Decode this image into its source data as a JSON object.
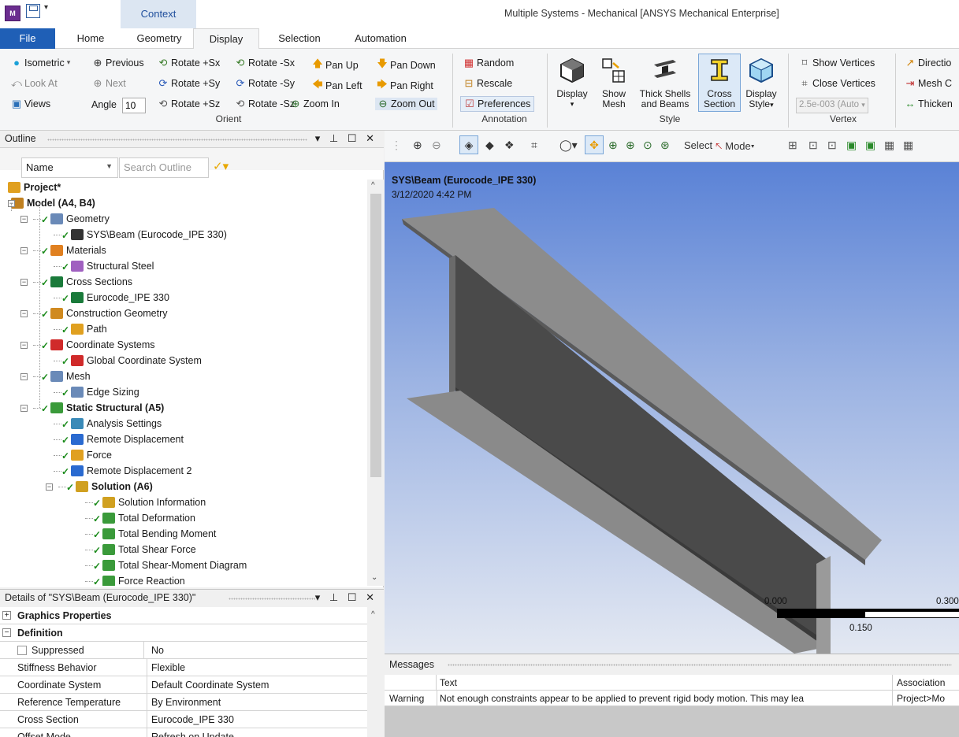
{
  "titlebar": {
    "app_icon": "M",
    "context_tab": "Context",
    "window_title": "Multiple Systems - Mechanical [ANSYS Mechanical Enterprise]"
  },
  "tabs": [
    "File",
    "Home",
    "Geometry",
    "Display",
    "Selection",
    "Automation"
  ],
  "active_tab": "Display",
  "ribbon": {
    "orient": {
      "isometric": "Isometric",
      "previous": "Previous",
      "look_at": "Look At",
      "next": "Next",
      "views": "Views",
      "angle_label": "Angle",
      "angle_value": "10",
      "rotate_psx": "Rotate +Sx",
      "rotate_msx": "Rotate -Sx",
      "rotate_psy": "Rotate +Sy",
      "rotate_msy": "Rotate -Sy",
      "rotate_psz": "Rotate +Sz",
      "rotate_msz": "Rotate -Sz",
      "pan_up": "Pan Up",
      "pan_down": "Pan Down",
      "pan_left": "Pan Left",
      "pan_right": "Pan Right",
      "zoom_in": "Zoom In",
      "zoom_out": "Zoom Out",
      "group_label": "Orient"
    },
    "annotation": {
      "random": "Random",
      "rescale": "Rescale",
      "preferences": "Preferences",
      "group_label": "Annotation"
    },
    "style": {
      "display": "Display",
      "show_mesh_1": "Show",
      "show_mesh_2": "Mesh",
      "thick_1": "Thick Shells",
      "thick_2": "and Beams",
      "cross_1": "Cross",
      "cross_2": "Section",
      "dstyle_1": "Display",
      "dstyle_2": "Style",
      "group_label": "Style"
    },
    "vertex": {
      "show_vertices": "Show Vertices",
      "close_vertices": "Close Vertices",
      "value": "2.5e-003 (Auto",
      "group_label": "Vertex"
    },
    "edge": {
      "direction": "Directio",
      "mesh_c": "Mesh C",
      "thicken": "Thicken"
    }
  },
  "outline": {
    "title": "Outline",
    "name_filter": "Name",
    "search_placeholder": "Search Outline",
    "tree": [
      {
        "label": "Project*",
        "bold": true
      },
      {
        "label": "Model (A4, B4)",
        "bold": true
      },
      {
        "label": "Geometry",
        "bold": false
      },
      {
        "label": "SYS\\Beam (Eurocode_IPE 330)",
        "bold": false
      },
      {
        "label": "Materials",
        "bold": false
      },
      {
        "label": "Structural Steel",
        "bold": false
      },
      {
        "label": "Cross Sections",
        "bold": false
      },
      {
        "label": "Eurocode_IPE 330",
        "bold": false
      },
      {
        "label": "Construction Geometry",
        "bold": false
      },
      {
        "label": "Path",
        "bold": false
      },
      {
        "label": "Coordinate Systems",
        "bold": false
      },
      {
        "label": "Global Coordinate System",
        "bold": false
      },
      {
        "label": "Mesh",
        "bold": false
      },
      {
        "label": "Edge Sizing",
        "bold": false
      },
      {
        "label": "Static Structural (A5)",
        "bold": true
      },
      {
        "label": "Analysis Settings",
        "bold": false
      },
      {
        "label": "Remote Displacement",
        "bold": false
      },
      {
        "label": "Force",
        "bold": false
      },
      {
        "label": "Remote Displacement 2",
        "bold": false
      },
      {
        "label": "Solution (A6)",
        "bold": true
      },
      {
        "label": "Solution Information",
        "bold": false
      },
      {
        "label": "Total Deformation",
        "bold": false
      },
      {
        "label": "Total Bending Moment",
        "bold": false
      },
      {
        "label": "Total Shear Force",
        "bold": false
      },
      {
        "label": "Total Shear-Moment Diagram",
        "bold": false
      },
      {
        "label": "Force Reaction",
        "bold": false
      }
    ]
  },
  "details": {
    "title": "Details of \"SYS\\Beam (Eurocode_IPE 330)\"",
    "sections": {
      "graphics": "Graphics Properties",
      "definition": "Definition"
    },
    "rows": [
      {
        "key": "Suppressed",
        "value": "No"
      },
      {
        "key": "Stiffness Behavior",
        "value": "Flexible"
      },
      {
        "key": "Coordinate System",
        "value": "Default Coordinate System"
      },
      {
        "key": "Reference Temperature",
        "value": "By Environment"
      },
      {
        "key": "Cross Section",
        "value": "Eurocode_IPE 330"
      },
      {
        "key": "Offset Mode",
        "value": "Refresh on Update"
      }
    ]
  },
  "graphics": {
    "toolbar_select": "Select",
    "toolbar_mode": "Mode",
    "title": "SYS\\Beam (Eurocode_IPE 330)",
    "timestamp": "3/12/2020 4:42 PM",
    "scale_0": "0.000",
    "scale_mid": "0.150",
    "scale_max": "0.300"
  },
  "messages": {
    "title": "Messages",
    "col_text": "Text",
    "col_assoc": "Association",
    "row_type": "Warning",
    "row_text": "Not enough constraints appear to be applied to prevent rigid body motion. This may lea",
    "row_assoc": "Project>Mo"
  },
  "colors": {
    "file_tab": "#1f5fb6",
    "context_tab": "#dce6f2",
    "viewport_top": "#5a82d6",
    "beam": "#8a8a8a"
  }
}
